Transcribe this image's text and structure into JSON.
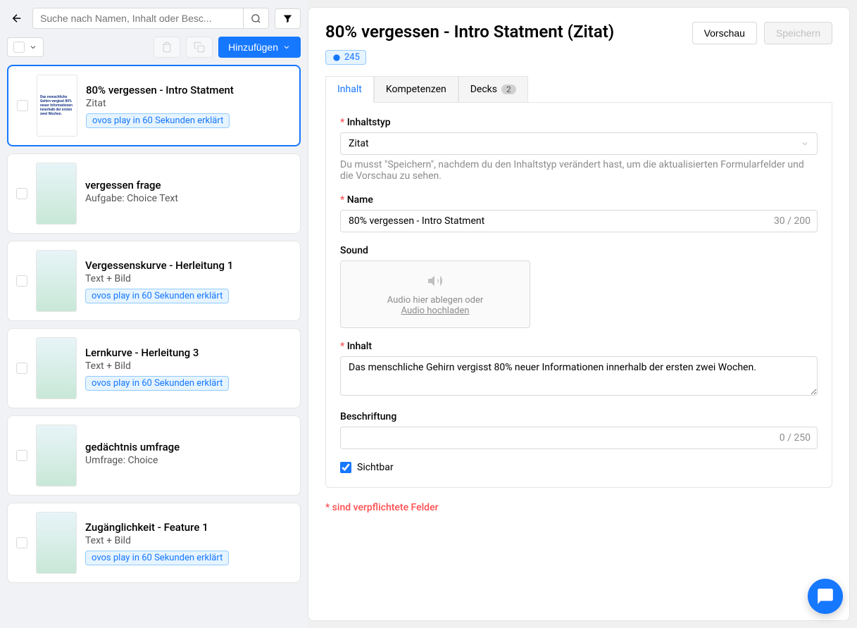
{
  "search": {
    "placeholder": "Suche nach Namen, Inhalt oder Besc..."
  },
  "toolbar": {
    "add": "Hinzufügen"
  },
  "cards": [
    {
      "title": "80% vergessen - Intro Statment",
      "subtitle": "Zitat",
      "tag": "ovos play in 60 Sekunden erklärt",
      "selected": true,
      "thumbText": "Das menschliche Gehirn vergisst 80% neuer Informationen innerhalb der ersten zwei Wochen."
    },
    {
      "title": "vergessen frage",
      "subtitle": "Aufgabe: Choice Text",
      "tag": null
    },
    {
      "title": "Vergessenskurve - Herleitung 1",
      "subtitle": "Text + Bild",
      "tag": "ovos play in 60 Sekunden erklärt"
    },
    {
      "title": "Lernkurve - Herleitung 3",
      "subtitle": "Text + Bild",
      "tag": "ovos play in 60 Sekunden erklärt"
    },
    {
      "title": "gedächtnis umfrage",
      "subtitle": "Umfrage: Choice",
      "tag": null
    },
    {
      "title": "Zugänglichkeit - Feature 1",
      "subtitle": "Text + Bild",
      "tag": "ovos play in 60 Sekunden erklärt"
    }
  ],
  "main": {
    "title": "80% vergessen - Intro Statment (Zitat)",
    "preview": "Vorschau",
    "save": "Speichern",
    "badge245": "245"
  },
  "tabs": {
    "content": "Inhalt",
    "competencies": "Kompetenzen",
    "decks": "Decks",
    "decksCount": "2"
  },
  "form": {
    "typeLabel": "Inhaltstyp",
    "typeValue": "Zitat",
    "typeHelp": "Du musst \"Speichern\", nachdem du den Inhaltstyp verändert hast, um die aktualisierten Formularfelder und die Vorschau zu sehen.",
    "nameLabel": "Name",
    "nameValue": "80% vergessen - Intro Statment",
    "nameCount": "30 / 200",
    "soundLabel": "Sound",
    "soundDrop": "Audio hier ablegen oder",
    "soundUpload": "Audio hochladen",
    "contentLabel": "Inhalt",
    "contentValue": "Das menschliche Gehirn vergisst 80% neuer Informationen innerhalb der ersten zwei Wochen.",
    "captionLabel": "Beschriftung",
    "captionCount": "0 / 250",
    "visibleLabel": "Sichtbar",
    "footnote": "* sind verpflichtete Felder"
  }
}
